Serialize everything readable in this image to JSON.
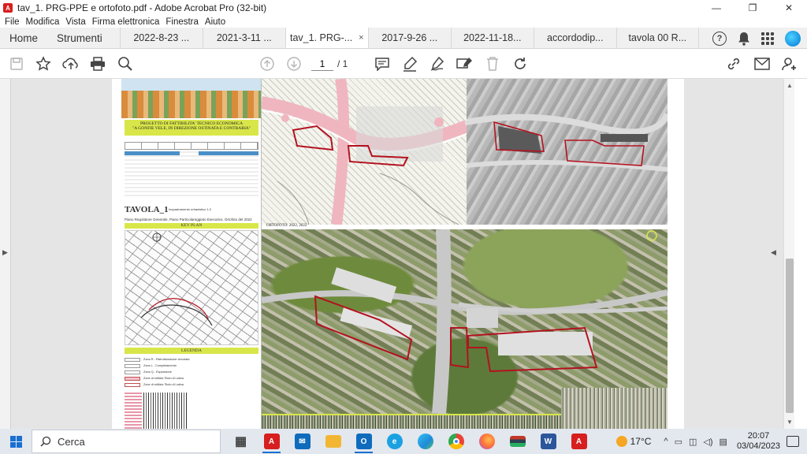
{
  "window": {
    "title": "tav_1. PRG-PPE e ortofoto.pdf - Adobe Acrobat Pro (32-bit)",
    "controls": {
      "minimize": "—",
      "restore": "❐",
      "close": "✕"
    }
  },
  "menu": [
    "File",
    "Modifica",
    "Vista",
    "Firma elettronica",
    "Finestra",
    "Aiuto"
  ],
  "tabs": {
    "home": "Home",
    "tools": "Strumenti",
    "documents": [
      {
        "label": "2022-8-23 ...",
        "active": false
      },
      {
        "label": "2021-3-11 ...",
        "active": false
      },
      {
        "label": "tav_1. PRG-...",
        "active": true,
        "close": "×"
      },
      {
        "label": "2017-9-26 ...",
        "active": false
      },
      {
        "label": "2022-11-18...",
        "active": false
      },
      {
        "label": "accordodip...",
        "active": false
      },
      {
        "label": "tavola 00 R...",
        "active": false
      }
    ],
    "help": "?"
  },
  "toolbar": {
    "page_current": "1",
    "page_total": "/ 1"
  },
  "document": {
    "cover": {
      "title_line1": "PROGETTO DI FATTIBILITA' TECNICO ECONOMICA",
      "title_line2": "\"A GONFIE VELE, IN DIREZIONE OSTINATA E CONTRARIA\"",
      "tavola": "TAVOLA_1",
      "tavola_sub": "Inquadramento urbanistico 1:2",
      "tavola_desc": "Piano Regolatore Generale, Piano Particolareggiato Esecutivo, Ortofoto del 2022",
      "key_plan": "KEY PLAN",
      "legenda": "LEGENDA",
      "legend_items": [
        "Zona R - Ristrutturazione vincolata",
        "Zona L - Completamento",
        "Zona Q - Espansione",
        "Zone di edilizia Titolo di Latina",
        "Zone di edilizia Titolo di Latina"
      ]
    },
    "ortofoto_label": "ORTOFOTO: 2022, 2022"
  },
  "taskbar": {
    "search_placeholder": "Cerca",
    "apps": [
      {
        "name": "task-view",
        "color": "#5a5a5a",
        "glyph": "▦",
        "active": false
      },
      {
        "name": "acrobat",
        "color": "#d71f1f",
        "glyph": "A",
        "active": true
      },
      {
        "name": "mail",
        "color": "#0f6cbd",
        "glyph": "✉",
        "active": false
      },
      {
        "name": "file-explorer",
        "color": "#f3b632",
        "glyph": "▬",
        "active": false
      },
      {
        "name": "outlook",
        "color": "#0f6cbd",
        "glyph": "O",
        "active": true
      },
      {
        "name": "internet-explorer",
        "color": "#1ba1e2",
        "glyph": "e",
        "active": false
      },
      {
        "name": "edge",
        "color": "#1f8ad8",
        "glyph": "e",
        "active": false
      },
      {
        "name": "chrome",
        "color": "#34a853",
        "glyph": "●",
        "active": false
      },
      {
        "name": "firefox",
        "color": "#ff7139",
        "glyph": "●",
        "active": false
      },
      {
        "name": "media",
        "color": "#444",
        "glyph": "▬",
        "active": false
      },
      {
        "name": "word",
        "color": "#2b579a",
        "glyph": "W",
        "active": false
      },
      {
        "name": "acrobat-2",
        "color": "#d71f1f",
        "glyph": "A",
        "active": false
      }
    ],
    "weather": "17°C",
    "time": "20:07",
    "date": "03/04/2023"
  }
}
